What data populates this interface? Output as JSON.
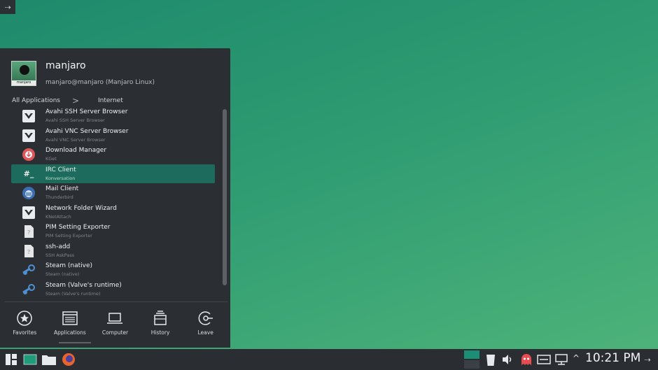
{
  "user": {
    "name": "manjaro",
    "host": "manjaro@manjaro (Manjaro Linux)",
    "avatar_label": "manjaro"
  },
  "breadcrumb": {
    "root": "All Applications",
    "separator": ">",
    "current": "Internet"
  },
  "apps": [
    {
      "name": "Avahi SSH Server Browser",
      "sub": "Avahi SSH Server Browser",
      "icon": "avahi-icon"
    },
    {
      "name": "Avahi VNC Server Browser",
      "sub": "Avahi VNC Server Browser",
      "icon": "avahi-icon"
    },
    {
      "name": "Download Manager",
      "sub": "KGet",
      "icon": "kget-icon"
    },
    {
      "name": "IRC Client",
      "sub": "Konversation",
      "icon": "konversation-icon",
      "selected": true
    },
    {
      "name": "Mail Client",
      "sub": "Thunderbird",
      "icon": "thunderbird-icon"
    },
    {
      "name": "Network Folder Wizard",
      "sub": "KNetAttach",
      "icon": "knetattach-icon"
    },
    {
      "name": "PIM Setting Exporter",
      "sub": "PIM Setting Exporter",
      "icon": "generic-file-icon"
    },
    {
      "name": "ssh-add",
      "sub": "SSH AskPass",
      "icon": "generic-file-icon"
    },
    {
      "name": "Steam (native)",
      "sub": "Steam (native)",
      "icon": "steam-icon"
    },
    {
      "name": "Steam (Valve's runtime)",
      "sub": "Steam (Valve's runtime)",
      "icon": "steam-icon"
    }
  ],
  "tabs": {
    "favorites": "Favorites",
    "applications": "Applications",
    "computer": "Computer",
    "history": "History",
    "leave": "Leave"
  },
  "active_tab": "applications",
  "taskbar": {
    "clock": "10:21 PM"
  },
  "colors": {
    "desktop_start": "#1e8a6c",
    "desktop_end": "#4fb47a",
    "panel": "#2b2f34",
    "selection": "#1d6b5c",
    "taskbar": "#2a2e32"
  }
}
